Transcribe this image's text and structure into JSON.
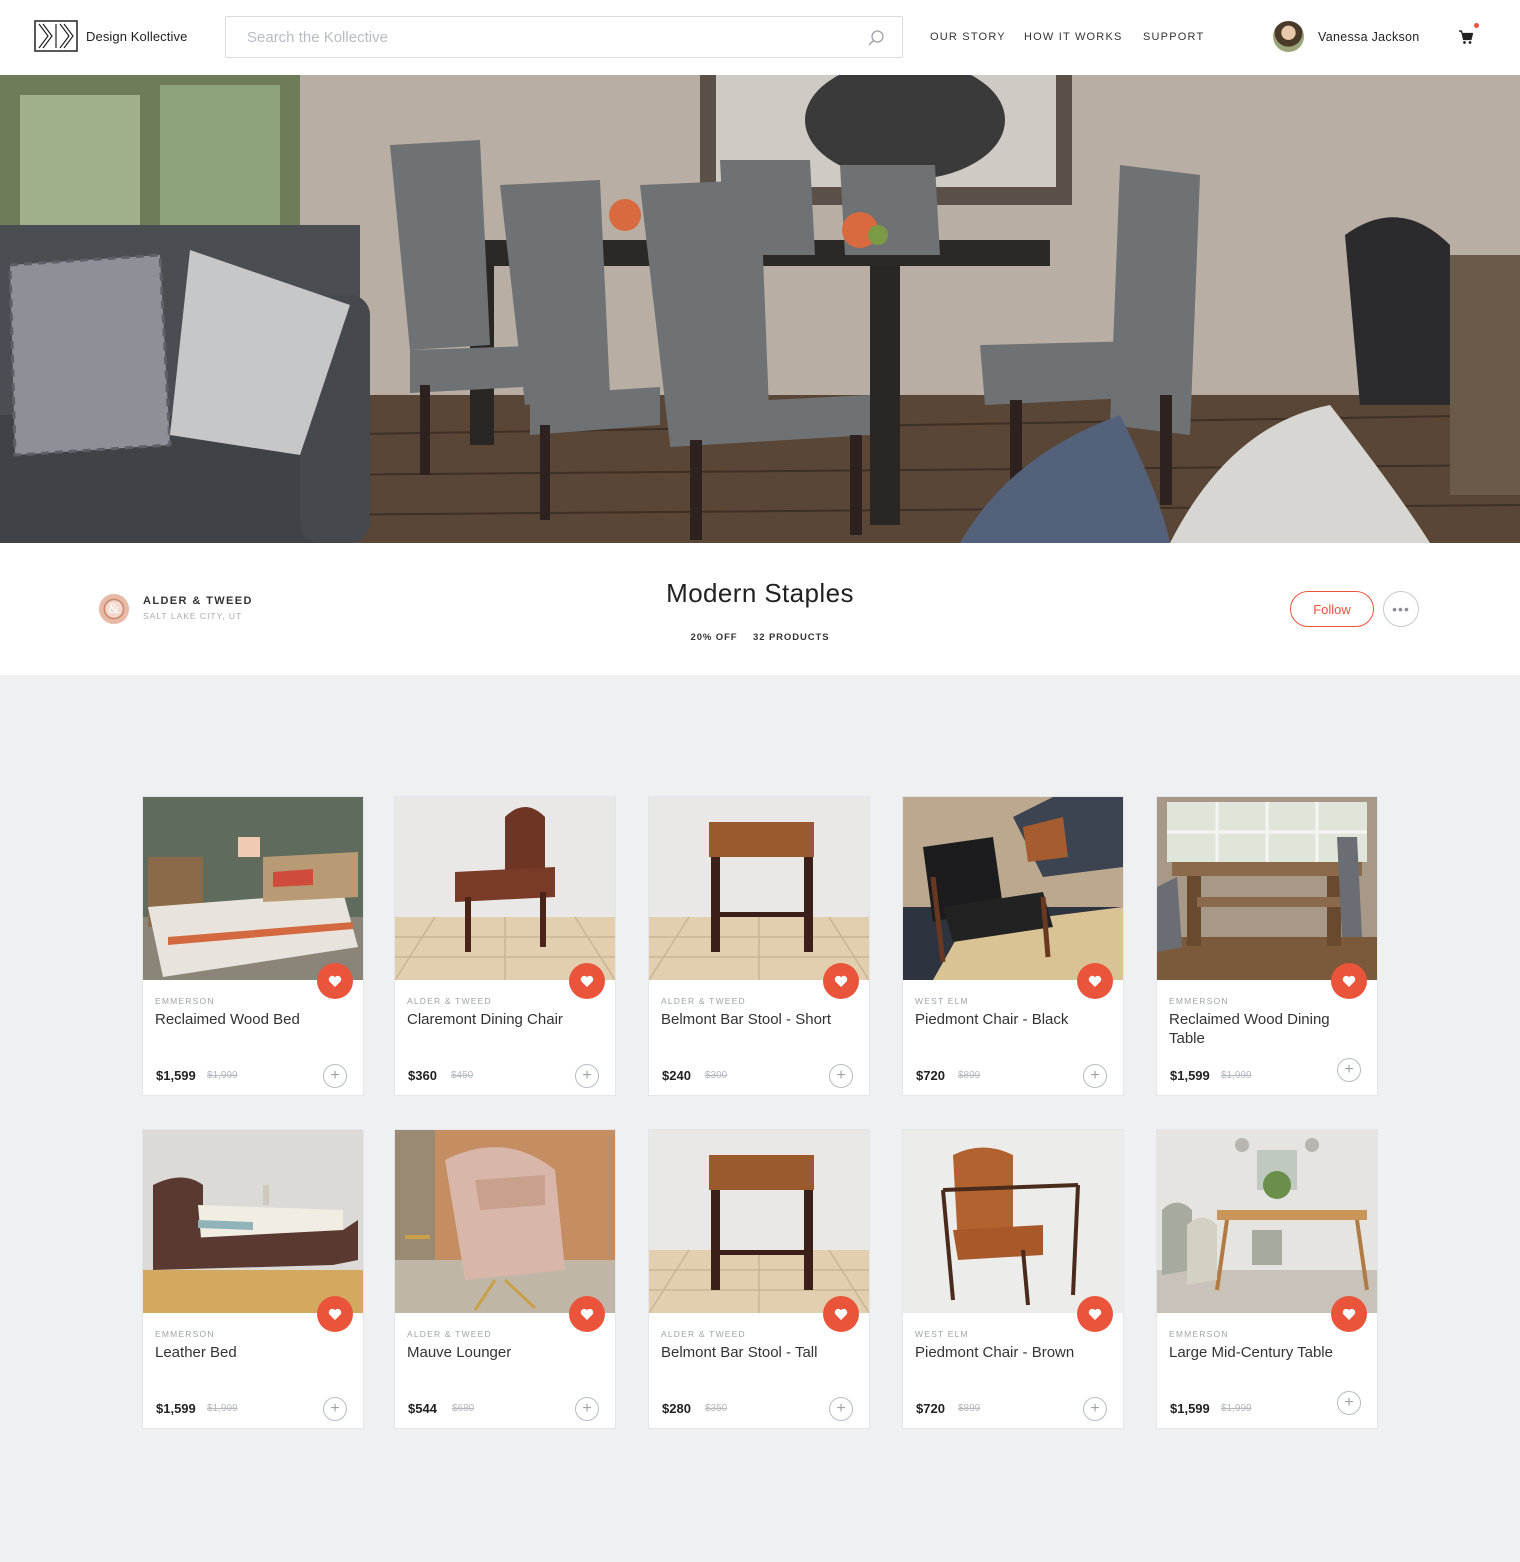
{
  "header": {
    "brand": "Design Kollective",
    "search_placeholder": "Search the Kollective",
    "nav": [
      "OUR STORY",
      "HOW IT WORKS",
      "SUPPORT"
    ],
    "user_name": "Vanessa Jackson"
  },
  "collection": {
    "brand_name": "ALDER & TWEED",
    "brand_location": "SALT LAKE CITY, UT",
    "title": "Modern Staples",
    "discount": "20% OFF",
    "product_count": "32 PRODUCTS",
    "follow_label": "Follow",
    "more_label": "•••"
  },
  "products": [
    {
      "vendor": "EMMERSON",
      "name": "Reclaimed Wood Bed",
      "price": "$1,599",
      "old_price": "$1,999"
    },
    {
      "vendor": "ALDER & TWEED",
      "name": "Claremont Dining Chair",
      "price": "$360",
      "old_price": "$450"
    },
    {
      "vendor": "ALDER & TWEED",
      "name": "Belmont Bar Stool - Short",
      "price": "$240",
      "old_price": "$300"
    },
    {
      "vendor": "WEST ELM",
      "name": "Piedmont Chair - Black",
      "price": "$720",
      "old_price": "$899"
    },
    {
      "vendor": "EMMERSON",
      "name": "Reclaimed Wood Dining Table",
      "price": "$1,599",
      "old_price": "$1,999"
    },
    {
      "vendor": "EMMERSON",
      "name": "Leather Bed",
      "price": "$1,599",
      "old_price": "$1,999"
    },
    {
      "vendor": "ALDER & TWEED",
      "name": "Mauve Lounger",
      "price": "$544",
      "old_price": "$680"
    },
    {
      "vendor": "ALDER & TWEED",
      "name": "Belmont Bar Stool - Tall",
      "price": "$280",
      "old_price": "$350"
    },
    {
      "vendor": "WEST ELM",
      "name": "Piedmont Chair - Brown",
      "price": "$720",
      "old_price": "$899"
    },
    {
      "vendor": "EMMERSON",
      "name": "Large Mid-Century Table",
      "price": "$1,599",
      "old_price": "$1,999"
    }
  ],
  "icons": {
    "search": "search-icon",
    "cart": "cart-icon",
    "favorite": "heart-icon",
    "add": "plus-icon"
  },
  "colors": {
    "accent": "#e9543b",
    "background": "#eff0f2"
  }
}
